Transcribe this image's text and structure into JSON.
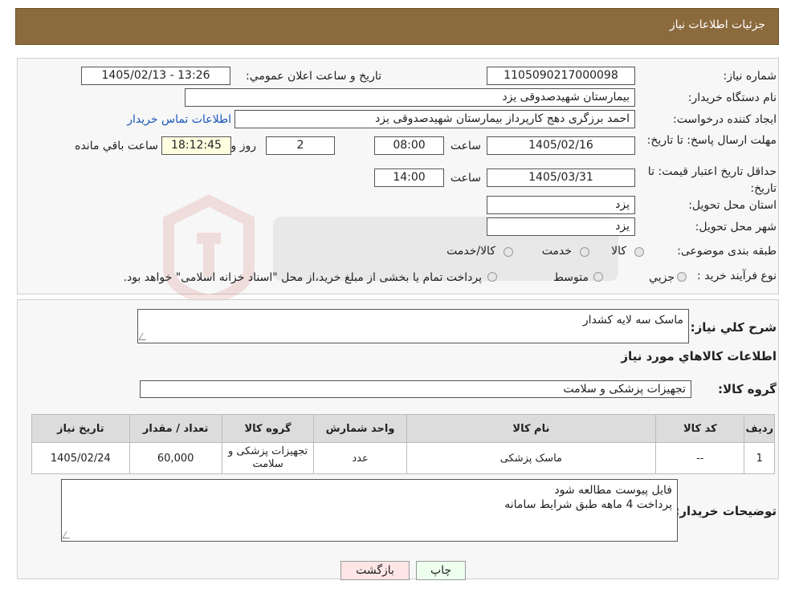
{
  "header": {
    "title": "جزئیات اطلاعات نیاز"
  },
  "form": {
    "need_number_label": "شماره نیاز:",
    "need_number": "1105090217000098",
    "announce_label": "تاریخ و ساعت اعلان عمومي:",
    "announce_value": "1405/02/13 - 13:26",
    "buyer_org_label": "نام دستگاه خریدار:",
    "buyer_org": "بیمارستان شهیدصدوقی یزد",
    "creator_label": "ایجاد کننده درخواست:",
    "creator": "احمد برزگری دهج کارپرداز بیمارستان شهیدصدوقی یزد",
    "contact_link": "اطلاعات تماس خریدار",
    "deadline_label": "مهلت ارسال پاسخ: تا تاریخ:",
    "deadline_date": "1405/02/16",
    "time_label": "ساعت",
    "deadline_time": "08:00",
    "days_value": "2",
    "days_label": "روز و",
    "remaining_time": "18:12:45",
    "remaining_label": "ساعت باقي مانده",
    "validity_label": "حداقل تاریخ اعتبار قیمت: تا تاریخ:",
    "validity_date": "1405/03/31",
    "validity_time": "14:00",
    "province_label": "استان محل تحویل:",
    "province": "یزد",
    "city_label": "شهر محل تحویل:",
    "city": "یزد",
    "category_label": "طبقه بندی موضوعی:",
    "category_options": [
      "کالا",
      "خدمت",
      "کالا/خدمت"
    ],
    "process_label": "نوع فرآیند خرید :",
    "process_options": [
      "جزیي",
      "متوسط"
    ],
    "process_note": "پرداخت تمام یا بخشی از مبلغ خرید،از محل \"اسناد خزانه اسلامی\" خواهد بود."
  },
  "details": {
    "summary_label": "شرح كلي نياز:",
    "summary": "ماسک سه لایه کشدار",
    "goods_info_title": "اطلاعات کالاهاي مورد نياز",
    "goods_group_label": "گروه کالا:",
    "goods_group": "تجهیزات پزشکی و سلامت"
  },
  "table": {
    "headers": [
      "رديف",
      "کد کالا",
      "نام کالا",
      "واحد شمارش",
      "گروه کالا",
      "تعداد / مقدار",
      "تاریخ نیاز"
    ],
    "rows": [
      {
        "row": "1",
        "code": "--",
        "name": "ماسک پزشکی",
        "unit": "عدد",
        "group": "تجهیزات پزشکی و سلامت",
        "qty": "60,000",
        "date": "1405/02/24"
      }
    ]
  },
  "buyer_notes": {
    "label": "توضیحات خریدار:",
    "lines": [
      "فایل پیوست مطالعه شود",
      "پرداخت 4 ماهه طبق شرایط سامانه"
    ]
  },
  "buttons": {
    "print": "چاپ",
    "back": "بازگشت"
  },
  "colors": {
    "header_bg": "#8b6a3e",
    "print_bg": "#eeffee",
    "back_bg": "#ffe6e6",
    "link": "#1a56b8"
  }
}
